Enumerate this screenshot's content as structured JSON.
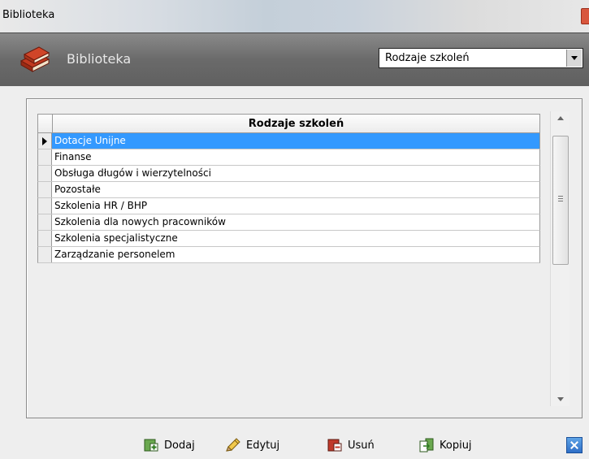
{
  "window": {
    "title": "Biblioteka"
  },
  "header": {
    "app_title": "Biblioteka",
    "combo_value": "Rodzaje szkoleń"
  },
  "grid": {
    "column_header": "Rodzaje szkoleń",
    "rows": [
      "Dotacje Unijne",
      "Finanse",
      "Obsługa długów i wierzytelności",
      "Pozostałe",
      "Szkolenia HR / BHP",
      "Szkolenia dla nowych pracowników",
      "Szkolenia specjalistyczne",
      "Zarządzanie personelem"
    ],
    "selected_index": 0
  },
  "toolbar": {
    "add_label": "Dodaj",
    "edit_label": "Edytuj",
    "delete_label": "Usuń",
    "copy_label": "Kopiuj"
  }
}
